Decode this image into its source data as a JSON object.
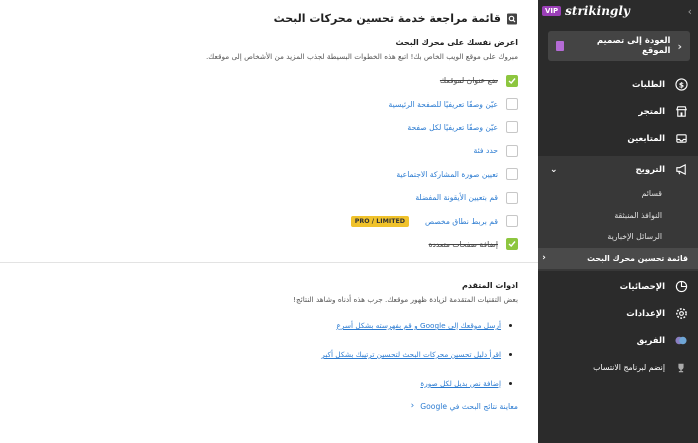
{
  "sidebar": {
    "vip": "VIP",
    "logo": "strikingly",
    "back_label": "العودة إلى تصميم الموقع",
    "items": [
      {
        "label": "الطلبات"
      },
      {
        "label": "المتجر"
      },
      {
        "label": "المتابعين"
      },
      {
        "label": "الترويج"
      },
      {
        "label": "الإحصائيات"
      },
      {
        "label": "الإعدادات"
      },
      {
        "label": "الفريق"
      },
      {
        "label": "إنضم لبرنامج الانتساب"
      }
    ],
    "subitems": [
      {
        "label": "قسائم"
      },
      {
        "label": "النوافذ المنبثقة"
      },
      {
        "label": "الرسائل الإخبارية"
      },
      {
        "label": "قائمة تحسين محرك البحث"
      }
    ]
  },
  "main": {
    "title": "قائمة مراجعة خدمة تحسين محركات البحث",
    "section1_heading": "اعرض نفسك على محرك البحث",
    "section1_desc": "مبروك على موقع الويب الخاص بك! اتبع هذه الخطوات البسيطة لجذب المزيد من الأشخاص إلى موقعك.",
    "checklist": [
      {
        "label": "ضع عنوان لموقعك",
        "done": true
      },
      {
        "label": "عيّن وصفًا تعريفيًا للصفحة الرئيسية",
        "done": false
      },
      {
        "label": "عيّن وصفًا تعريفيًا لكل صفحة",
        "done": false
      },
      {
        "label": "حدد فئة",
        "done": false
      },
      {
        "label": "تعيين صورة المشاركة الاجتماعية",
        "done": false
      },
      {
        "label": "قم بتعيين الأيقونة المفضلة",
        "done": false
      },
      {
        "label": "قم بربط نطاق مخصص",
        "done": false,
        "badge": "PRO / LIMITED"
      },
      {
        "label": "إضافة صفحات متعددة",
        "done": true
      }
    ],
    "section2_heading": "ادوات المتقدم",
    "section2_desc": "بعض التقنيات المتقدمة لزيادة ظهور موقعك. جرب هذه أدناه وشاهد النتائج!",
    "advanced": [
      {
        "label": "أرسل موقعك إلى Google و قم بفهرسته بشكل أسرع"
      },
      {
        "label": "اقرأ دليل تحسين محركات البحث لتحسين ترتيبك بشكل أكبر"
      },
      {
        "label": "إضافة نص بديل لكل صورة"
      }
    ],
    "preview_label": "معاينة نتائج البحث في Google"
  }
}
